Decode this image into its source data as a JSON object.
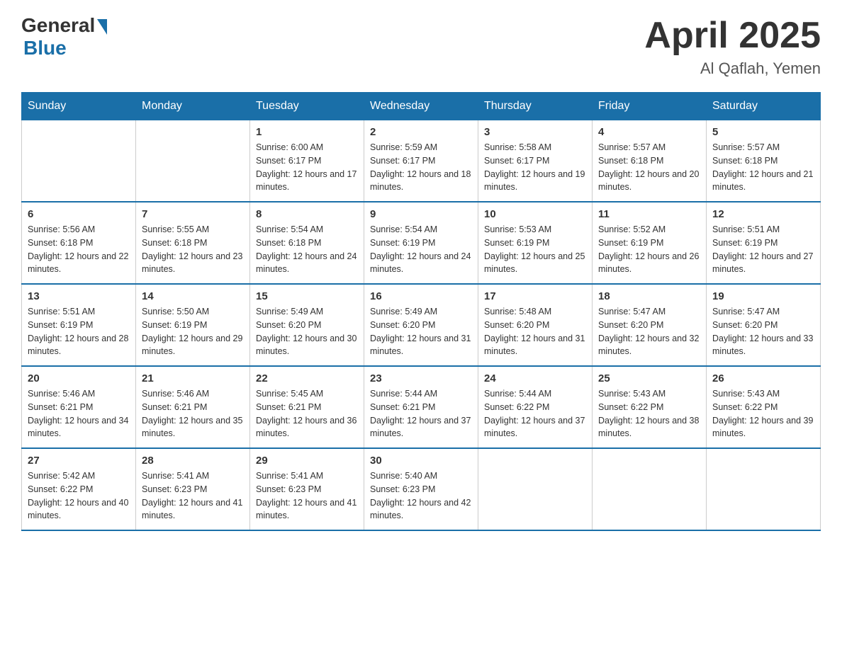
{
  "header": {
    "logo_general": "General",
    "logo_blue": "Blue",
    "month_title": "April 2025",
    "location": "Al Qaflah, Yemen"
  },
  "days_of_week": [
    "Sunday",
    "Monday",
    "Tuesday",
    "Wednesday",
    "Thursday",
    "Friday",
    "Saturday"
  ],
  "weeks": [
    [
      {
        "day": "",
        "sunrise": "",
        "sunset": "",
        "daylight": ""
      },
      {
        "day": "",
        "sunrise": "",
        "sunset": "",
        "daylight": ""
      },
      {
        "day": "1",
        "sunrise": "Sunrise: 6:00 AM",
        "sunset": "Sunset: 6:17 PM",
        "daylight": "Daylight: 12 hours and 17 minutes."
      },
      {
        "day": "2",
        "sunrise": "Sunrise: 5:59 AM",
        "sunset": "Sunset: 6:17 PM",
        "daylight": "Daylight: 12 hours and 18 minutes."
      },
      {
        "day": "3",
        "sunrise": "Sunrise: 5:58 AM",
        "sunset": "Sunset: 6:17 PM",
        "daylight": "Daylight: 12 hours and 19 minutes."
      },
      {
        "day": "4",
        "sunrise": "Sunrise: 5:57 AM",
        "sunset": "Sunset: 6:18 PM",
        "daylight": "Daylight: 12 hours and 20 minutes."
      },
      {
        "day": "5",
        "sunrise": "Sunrise: 5:57 AM",
        "sunset": "Sunset: 6:18 PM",
        "daylight": "Daylight: 12 hours and 21 minutes."
      }
    ],
    [
      {
        "day": "6",
        "sunrise": "Sunrise: 5:56 AM",
        "sunset": "Sunset: 6:18 PM",
        "daylight": "Daylight: 12 hours and 22 minutes."
      },
      {
        "day": "7",
        "sunrise": "Sunrise: 5:55 AM",
        "sunset": "Sunset: 6:18 PM",
        "daylight": "Daylight: 12 hours and 23 minutes."
      },
      {
        "day": "8",
        "sunrise": "Sunrise: 5:54 AM",
        "sunset": "Sunset: 6:18 PM",
        "daylight": "Daylight: 12 hours and 24 minutes."
      },
      {
        "day": "9",
        "sunrise": "Sunrise: 5:54 AM",
        "sunset": "Sunset: 6:19 PM",
        "daylight": "Daylight: 12 hours and 24 minutes."
      },
      {
        "day": "10",
        "sunrise": "Sunrise: 5:53 AM",
        "sunset": "Sunset: 6:19 PM",
        "daylight": "Daylight: 12 hours and 25 minutes."
      },
      {
        "day": "11",
        "sunrise": "Sunrise: 5:52 AM",
        "sunset": "Sunset: 6:19 PM",
        "daylight": "Daylight: 12 hours and 26 minutes."
      },
      {
        "day": "12",
        "sunrise": "Sunrise: 5:51 AM",
        "sunset": "Sunset: 6:19 PM",
        "daylight": "Daylight: 12 hours and 27 minutes."
      }
    ],
    [
      {
        "day": "13",
        "sunrise": "Sunrise: 5:51 AM",
        "sunset": "Sunset: 6:19 PM",
        "daylight": "Daylight: 12 hours and 28 minutes."
      },
      {
        "day": "14",
        "sunrise": "Sunrise: 5:50 AM",
        "sunset": "Sunset: 6:19 PM",
        "daylight": "Daylight: 12 hours and 29 minutes."
      },
      {
        "day": "15",
        "sunrise": "Sunrise: 5:49 AM",
        "sunset": "Sunset: 6:20 PM",
        "daylight": "Daylight: 12 hours and 30 minutes."
      },
      {
        "day": "16",
        "sunrise": "Sunrise: 5:49 AM",
        "sunset": "Sunset: 6:20 PM",
        "daylight": "Daylight: 12 hours and 31 minutes."
      },
      {
        "day": "17",
        "sunrise": "Sunrise: 5:48 AM",
        "sunset": "Sunset: 6:20 PM",
        "daylight": "Daylight: 12 hours and 31 minutes."
      },
      {
        "day": "18",
        "sunrise": "Sunrise: 5:47 AM",
        "sunset": "Sunset: 6:20 PM",
        "daylight": "Daylight: 12 hours and 32 minutes."
      },
      {
        "day": "19",
        "sunrise": "Sunrise: 5:47 AM",
        "sunset": "Sunset: 6:20 PM",
        "daylight": "Daylight: 12 hours and 33 minutes."
      }
    ],
    [
      {
        "day": "20",
        "sunrise": "Sunrise: 5:46 AM",
        "sunset": "Sunset: 6:21 PM",
        "daylight": "Daylight: 12 hours and 34 minutes."
      },
      {
        "day": "21",
        "sunrise": "Sunrise: 5:46 AM",
        "sunset": "Sunset: 6:21 PM",
        "daylight": "Daylight: 12 hours and 35 minutes."
      },
      {
        "day": "22",
        "sunrise": "Sunrise: 5:45 AM",
        "sunset": "Sunset: 6:21 PM",
        "daylight": "Daylight: 12 hours and 36 minutes."
      },
      {
        "day": "23",
        "sunrise": "Sunrise: 5:44 AM",
        "sunset": "Sunset: 6:21 PM",
        "daylight": "Daylight: 12 hours and 37 minutes."
      },
      {
        "day": "24",
        "sunrise": "Sunrise: 5:44 AM",
        "sunset": "Sunset: 6:22 PM",
        "daylight": "Daylight: 12 hours and 37 minutes."
      },
      {
        "day": "25",
        "sunrise": "Sunrise: 5:43 AM",
        "sunset": "Sunset: 6:22 PM",
        "daylight": "Daylight: 12 hours and 38 minutes."
      },
      {
        "day": "26",
        "sunrise": "Sunrise: 5:43 AM",
        "sunset": "Sunset: 6:22 PM",
        "daylight": "Daylight: 12 hours and 39 minutes."
      }
    ],
    [
      {
        "day": "27",
        "sunrise": "Sunrise: 5:42 AM",
        "sunset": "Sunset: 6:22 PM",
        "daylight": "Daylight: 12 hours and 40 minutes."
      },
      {
        "day": "28",
        "sunrise": "Sunrise: 5:41 AM",
        "sunset": "Sunset: 6:23 PM",
        "daylight": "Daylight: 12 hours and 41 minutes."
      },
      {
        "day": "29",
        "sunrise": "Sunrise: 5:41 AM",
        "sunset": "Sunset: 6:23 PM",
        "daylight": "Daylight: 12 hours and 41 minutes."
      },
      {
        "day": "30",
        "sunrise": "Sunrise: 5:40 AM",
        "sunset": "Sunset: 6:23 PM",
        "daylight": "Daylight: 12 hours and 42 minutes."
      },
      {
        "day": "",
        "sunrise": "",
        "sunset": "",
        "daylight": ""
      },
      {
        "day": "",
        "sunrise": "",
        "sunset": "",
        "daylight": ""
      },
      {
        "day": "",
        "sunrise": "",
        "sunset": "",
        "daylight": ""
      }
    ]
  ]
}
